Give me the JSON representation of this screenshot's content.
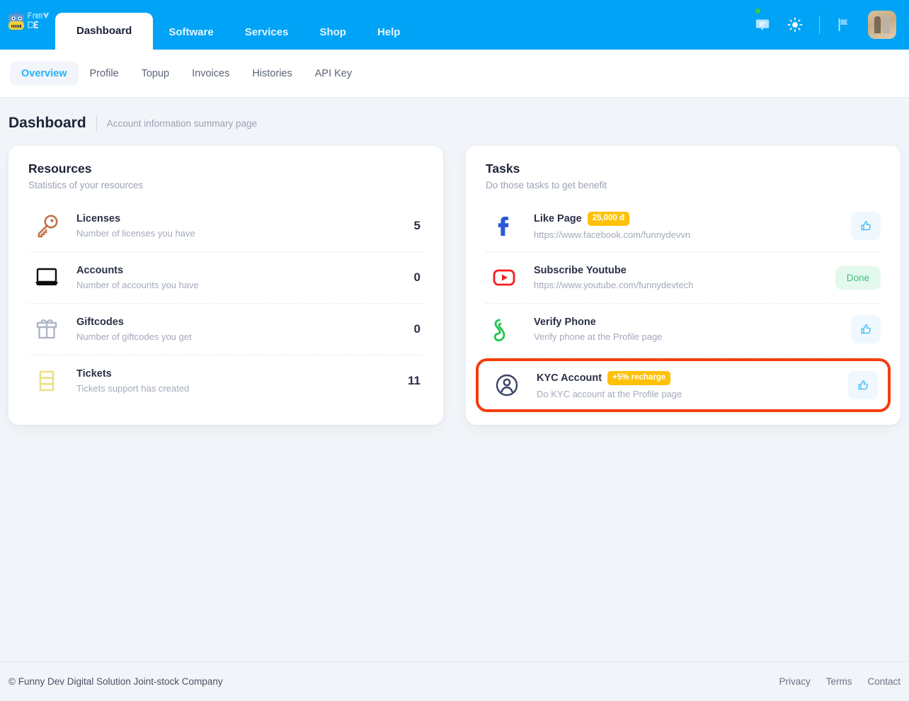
{
  "colors": {
    "header_blue": "#00a3f5",
    "accent_blue": "#26b3f7",
    "badge_yellow": "#ffc107",
    "done_green": "#42bf7f",
    "highlight_red": "#f53d0c",
    "page_bg": "#f1f4f8"
  },
  "header": {
    "logo_name": "funny-dev-logo",
    "tabs": [
      {
        "label": "Dashboard",
        "active": true
      },
      {
        "label": "Software",
        "active": false
      },
      {
        "label": "Services",
        "active": false
      },
      {
        "label": "Shop",
        "active": false
      },
      {
        "label": "Help",
        "active": false
      }
    ],
    "icons": [
      {
        "name": "chat-bubble-icon",
        "has_status_dot": true
      },
      {
        "name": "sun-theme-icon",
        "has_status_dot": false
      },
      {
        "name": "flag-language-icon",
        "has_status_dot": false
      }
    ],
    "avatar_name": "user-avatar"
  },
  "subnav": {
    "items": [
      {
        "label": "Overview",
        "active": true
      },
      {
        "label": "Profile",
        "active": false
      },
      {
        "label": "Topup",
        "active": false
      },
      {
        "label": "Invoices",
        "active": false
      },
      {
        "label": "Histories",
        "active": false
      },
      {
        "label": "API Key",
        "active": false
      }
    ]
  },
  "page": {
    "title": "Dashboard",
    "subtitle": "Account information summary page"
  },
  "resources": {
    "title": "Resources",
    "subtitle": "Statistics of your resources",
    "items": [
      {
        "icon": "key-icon",
        "title": "Licenses",
        "desc": "Number of licenses you have",
        "value": "5"
      },
      {
        "icon": "laptop-icon",
        "title": "Accounts",
        "desc": "Number of accounts you have",
        "value": "0"
      },
      {
        "icon": "gift-icon",
        "title": "Giftcodes",
        "desc": "Number of giftcodes you get",
        "value": "0"
      },
      {
        "icon": "ticket-icon",
        "title": "Tickets",
        "desc": "Tickets support has created",
        "value": "11"
      }
    ]
  },
  "tasks": {
    "title": "Tasks",
    "subtitle": "Do those tasks to get benefit",
    "items": [
      {
        "icon": "facebook-icon",
        "title": "Like Page",
        "badge": "25,000 đ",
        "desc": "https://www.facebook.com/funnydevvn",
        "action": "like-button",
        "action_label": "",
        "highlighted": false
      },
      {
        "icon": "youtube-icon",
        "title": "Subscribe Youtube",
        "badge": "",
        "desc": "https://www.youtube.com/funnydevtech",
        "action": "done-badge",
        "action_label": "Done",
        "highlighted": false
      },
      {
        "icon": "phone-icon",
        "title": "Verify Phone",
        "badge": "",
        "desc": "Verify phone at the Profile page",
        "action": "like-button",
        "action_label": "",
        "highlighted": false
      },
      {
        "icon": "user-circle-icon",
        "title": "KYC Account",
        "badge": "+5% recharge",
        "desc": "Do KYC account at the Profile page",
        "action": "like-button",
        "action_label": "",
        "highlighted": true
      }
    ]
  },
  "footer": {
    "copyright": "© Funny Dev Digital Solution Joint-stock Company",
    "links": [
      {
        "label": "Privacy"
      },
      {
        "label": "Terms"
      },
      {
        "label": "Contact"
      }
    ]
  }
}
